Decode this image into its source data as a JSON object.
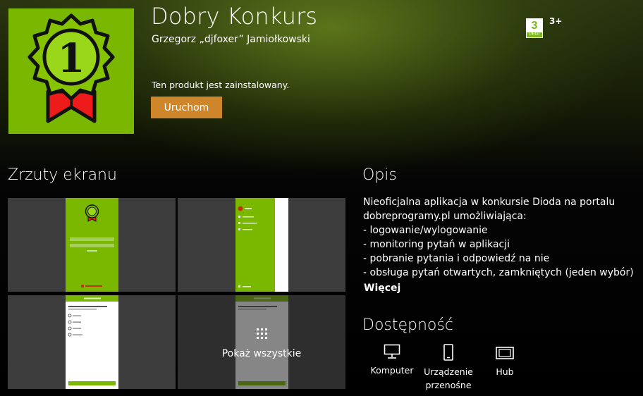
{
  "app": {
    "title": "Dobry Konkurs",
    "author": "Grzegorz „djfoxer” Jamiołkowski",
    "install_status": "Ten produkt jest zainstalowany.",
    "launch_label": "Uruchom",
    "tile_color": "#79b700",
    "medal_number": "1"
  },
  "rating": {
    "pegi_number": "3",
    "pegi_text": "PEGI",
    "age_label": "3+"
  },
  "screenshots": {
    "heading": "Zrzuty ekranu",
    "show_all_label": "Pokaż wszystkie"
  },
  "description": {
    "heading": "Opis",
    "lines": [
      "Nieoficjalna aplikacja w konkursie Dioda na portalu",
      "dobreprogramy.pl umożliwiająca:",
      "- logowanie/wylogowanie",
      "- monitoring pytań w aplikacji",
      "- pobranie pytania i odpowiedź na nie",
      "- obsługa pytań otwartych, zamkniętych (jeden wybór) i..."
    ],
    "more_label": "Więcej"
  },
  "availability": {
    "heading": "Dostępność",
    "devices": [
      {
        "label": "Komputer",
        "icon": "computer-icon"
      },
      {
        "label": "Urządzenie przenośne",
        "icon": "mobile-device-icon"
      },
      {
        "label": "Hub",
        "icon": "hub-icon"
      }
    ]
  },
  "colors": {
    "accent_button": "#cf862a",
    "pegi_green": "#7cb61d"
  }
}
